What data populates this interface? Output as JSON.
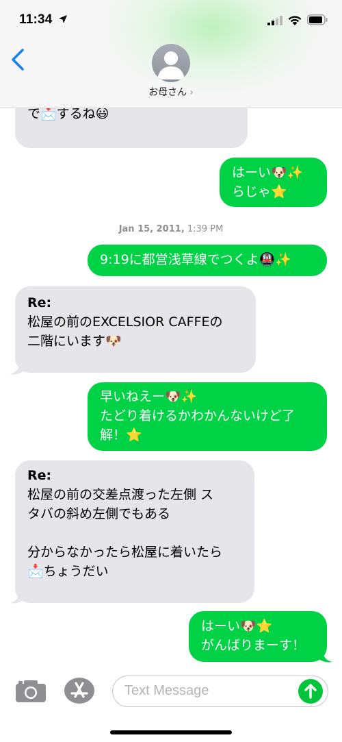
{
  "status_bar": {
    "time": "11:34"
  },
  "header": {
    "contact_name": "お母さん",
    "chevron": "›"
  },
  "timestamp": {
    "date": "Jan 15, 2011,",
    "time": "1:39 PM"
  },
  "messages": [
    {
      "direction": "in",
      "text": "で📩するね😃"
    },
    {
      "direction": "out",
      "lines": [
        "はーい🐶✨",
        "らじゃ⭐"
      ]
    },
    {
      "direction": "out",
      "text": "9:19に都営浅草線でつくよ🚇✨"
    },
    {
      "direction": "in",
      "title": "Re:",
      "lines": [
        "松屋の前のEXCELSIOR CAFFEの",
        "二階にいます🐶"
      ]
    },
    {
      "direction": "out",
      "lines": [
        "早いねえー🐶✨",
        "たどり着けるかわかんないけど了",
        "解！⭐"
      ]
    },
    {
      "direction": "in",
      "title": "Re:",
      "lines": [
        "松屋の前の交差点渡った左側 ス",
        "タバの斜め左側でもある",
        "",
        "分からなかったら松屋に着いたら",
        "📩ちょうだい"
      ]
    },
    {
      "direction": "out",
      "lines": [
        "はーい🐶⭐",
        "がんばりまーす！"
      ]
    }
  ],
  "input_bar": {
    "placeholder": "Text Message"
  },
  "colors": {
    "outgoing": "#00d246",
    "incoming": "#e5e5ea",
    "accent": "#147efb"
  },
  "icons": [
    "location-arrow-icon",
    "signal-icon",
    "wifi-icon",
    "battery-icon",
    "back-chevron-icon",
    "person-icon",
    "camera-icon",
    "app-store-icon",
    "send-arrow-icon"
  ]
}
